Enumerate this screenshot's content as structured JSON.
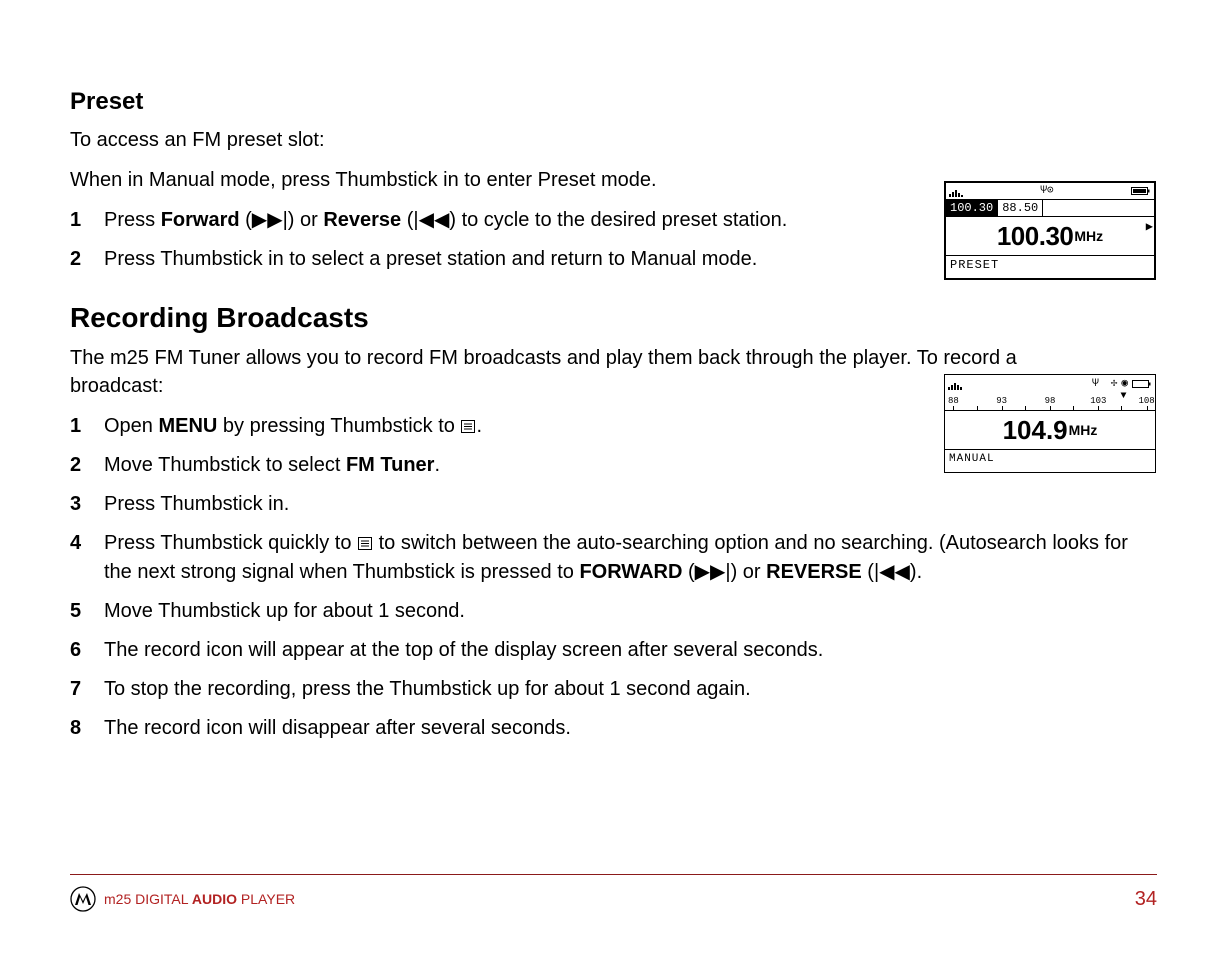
{
  "preset": {
    "title": "Preset",
    "intro1": "To access an FM preset slot:",
    "intro2": "When in Manual mode, press Thumbstick in to enter Preset mode.",
    "steps": [
      {
        "num": "1",
        "pre": "Press ",
        "b1": "Forward",
        "mid1": " (▶▶|) or ",
        "b2": "Reverse",
        "post": " (|◀◀) to cycle to the desired preset station."
      },
      {
        "num": "2",
        "text": "Press Thumbstick in to select a preset station and return to Manual mode."
      }
    ]
  },
  "recording": {
    "title": "Recording Broadcasts",
    "intro": "The m25 FM Tuner allows you to record FM broadcasts and play them back through the player. To record a broadcast:",
    "steps": [
      {
        "num": "1",
        "pre": "Open ",
        "b1": "MENU",
        "post_pre": " by pressing Thumbstick to ",
        "post_post": "."
      },
      {
        "num": "2",
        "pre": "Move Thumbstick to select ",
        "b1": "FM Tuner",
        "post": "."
      },
      {
        "num": "3",
        "text": "Press Thumbstick in."
      },
      {
        "num": "4",
        "pre": "Press Thumbstick quickly to ",
        "mid": " to switch between the auto-searching option and no searching. (Autosearch looks for the next strong signal when Thumbstick is pressed to ",
        "b1": "FORWARD",
        "mid2": " (▶▶|) or ",
        "b2": "REVERSE",
        "post": " (|◀◀)."
      },
      {
        "num": "5",
        "text": "Move Thumbstick up for about 1 second."
      },
      {
        "num": "6",
        "text": "The record icon will appear at the top of the display screen after several seconds."
      },
      {
        "num": "7",
        "text": "To stop the recording, press the Thumbstick up for about 1 second again."
      },
      {
        "num": "8",
        "text": "The record icon will disappear after several seconds."
      }
    ]
  },
  "lcd1": {
    "tab1": "100.30",
    "tab2": "88.50",
    "freq": "100.30",
    "unit": "MHz",
    "mode": "PRESET"
  },
  "lcd2": {
    "ticks": [
      "88",
      "93",
      "98",
      "103",
      "108"
    ],
    "freq": "104.9",
    "unit": "MHz",
    "mode": "MANUAL"
  },
  "footer": {
    "model": "m25",
    "digital": " DIGITAL ",
    "audio": "AUDIO",
    "player": " PLAYER",
    "page": "34"
  }
}
